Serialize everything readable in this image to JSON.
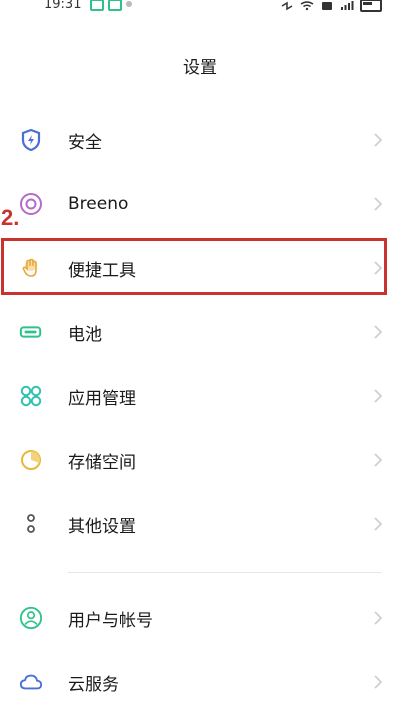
{
  "status_bar": {
    "time": "19:31",
    "accent_color": "#2ec28a"
  },
  "header": {
    "title": "设置"
  },
  "annotation": {
    "label": "2.",
    "color": "#c9332e"
  },
  "settings": {
    "items": [
      {
        "label": "安全",
        "icon": "shield-icon",
        "color": "#4a6fd6"
      },
      {
        "label": "Breeno",
        "icon": "breeno-icon",
        "color": "#b46bc9"
      },
      {
        "label": "便捷工具",
        "icon": "hand-icon",
        "color": "#e8a93a"
      },
      {
        "label": "电池",
        "icon": "battery-icon",
        "color": "#2ec28a"
      },
      {
        "label": "应用管理",
        "icon": "app-grid-icon",
        "color": "#2ec2b0"
      },
      {
        "label": "存储空间",
        "icon": "storage-pie-icon",
        "color": "#e6b93a"
      },
      {
        "label": "其他设置",
        "icon": "more-settings-icon",
        "color": "#555555"
      },
      {
        "label": "用户与帐号",
        "icon": "user-icon",
        "color": "#2ec28a"
      },
      {
        "label": "云服务",
        "icon": "cloud-icon",
        "color": "#4a6fd6"
      }
    ]
  }
}
